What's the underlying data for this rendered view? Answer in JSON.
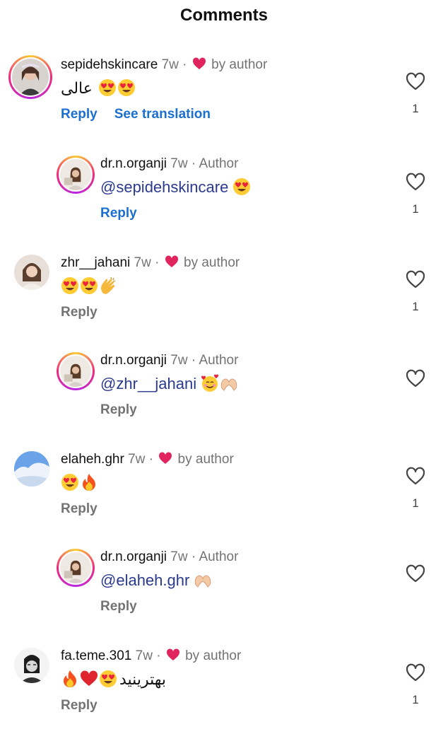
{
  "header": {
    "title": "Comments"
  },
  "comments": [
    {
      "username": "sepidehskincare",
      "time": "7w",
      "tag": "by author",
      "text_rtl": "عالی",
      "emojis_after": [
        "heart-eyes",
        "heart-eyes"
      ],
      "reply_label": "Reply",
      "translate_label": "See translation",
      "like_count": "1"
    },
    {
      "username": "dr.n.organji",
      "time": "7w",
      "tag": "Author",
      "mention": "@sepidehskincare",
      "emojis_after": [
        "heart-eyes"
      ],
      "reply_label": "Reply",
      "like_count": "1"
    },
    {
      "username": "zhr__jahani",
      "time": "7w",
      "tag": "by author",
      "emojis_after": [
        "heart-eyes",
        "heart-eyes",
        "clapping-hands"
      ],
      "reply_label": "Reply",
      "like_count": "1"
    },
    {
      "username": "dr.n.organji",
      "time": "7w",
      "tag": "Author",
      "mention": "@zhr__jahani",
      "emojis_after": [
        "smiling-face-with-hearts",
        "heart-hands"
      ],
      "reply_label": "Reply"
    },
    {
      "username": "elaheh.ghr",
      "time": "7w",
      "tag": "by author",
      "emojis_after": [
        "heart-eyes",
        "fire"
      ],
      "reply_label": "Reply",
      "like_count": "1"
    },
    {
      "username": "dr.n.organji",
      "time": "7w",
      "tag": "Author",
      "mention": "@elaheh.ghr",
      "emojis_after": [
        "heart-hands"
      ],
      "reply_label": "Reply"
    },
    {
      "username": "fa.teme.301",
      "time": "7w",
      "tag": "by author",
      "emojis_before": [
        "fire",
        "red-heart",
        "heart-eyes"
      ],
      "text_rtl": "بهترینید",
      "reply_label": "Reply",
      "like_count": "1"
    }
  ],
  "separator": "·",
  "colors": {
    "link": "#1a6fd1",
    "secondary": "#737373",
    "heart": "#e0245e",
    "mention": "#2b3a8f"
  }
}
